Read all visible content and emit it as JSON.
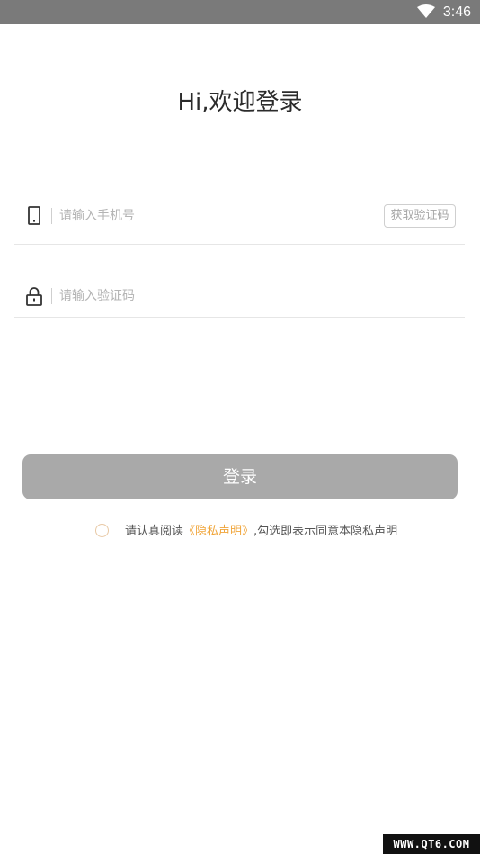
{
  "status_bar": {
    "time": "3:46",
    "wifi_icon": "wifi-icon",
    "background": "#7a7a7a"
  },
  "login": {
    "title": "Hi,欢迎登录",
    "phone_field": {
      "icon": "phone-icon",
      "placeholder": "请输入手机号",
      "value": ""
    },
    "get_code_button": "获取验证码",
    "code_field": {
      "icon": "lock-icon",
      "placeholder": "请输入验证码",
      "value": ""
    },
    "submit_button": "登录",
    "submit_color": "#a9a9a9",
    "agreement": {
      "checked": false,
      "prefix": "请认真阅读",
      "link": "《隐私声明》",
      "suffix": ",勾选即表示同意本隐私声明",
      "link_color": "#f0a53a"
    }
  },
  "watermark": "WWW.QT6.COM"
}
